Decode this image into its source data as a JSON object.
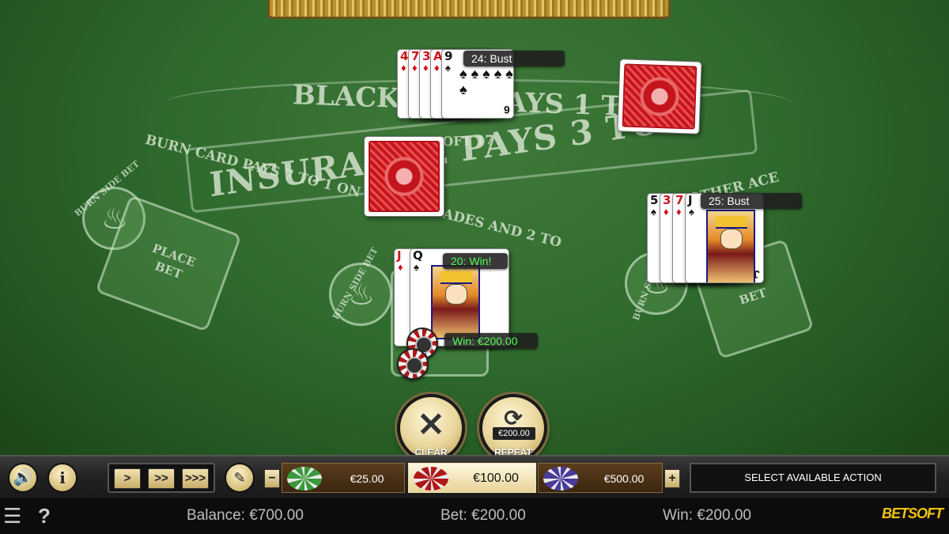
{
  "table": {
    "title_text": "BLACKJACK PAYS 1 TO",
    "rule_text": "HITS ON SOFT 17",
    "insurance_text": "INSURANCE PAYS 3 TO 2",
    "burn_rule_text": "BURN CARD PAYS 7 TO 1 ON ACE OF SPADES AND 2 TO",
    "burn_rule_text_2": "OTHER ACE",
    "burn_side_bet": "BURN SIDE BET",
    "place_bet": "PLACE\nBET",
    "bet_spot_right": "BET"
  },
  "hands": {
    "dealer": {
      "label": "24: Bust",
      "cards": [
        {
          "rank": "4",
          "suit": "♦",
          "color": "red"
        },
        {
          "rank": "7",
          "suit": "♦",
          "color": "red"
        },
        {
          "rank": "3",
          "suit": "♦",
          "color": "red"
        },
        {
          "rank": "A",
          "suit": "♦",
          "color": "red"
        },
        {
          "rank": "9",
          "suit": "♠",
          "color": "black"
        }
      ],
      "last_card_corner": "6"
    },
    "player_center": {
      "label": "20: Win!",
      "win_text": "Win: €200.00",
      "cards": [
        {
          "rank": "J",
          "suit": "♦",
          "color": "red"
        },
        {
          "rank": "Q",
          "suit": "♠",
          "color": "black"
        }
      ]
    },
    "player_right": {
      "label": "25: Bust",
      "cards": [
        {
          "rank": "5",
          "suit": "♠",
          "color": "black"
        },
        {
          "rank": "3",
          "suit": "♦",
          "color": "red"
        },
        {
          "rank": "7",
          "suit": "♦",
          "color": "red"
        },
        {
          "rank": "J",
          "suit": "♠",
          "color": "black"
        }
      ],
      "last_card_corner": "J"
    }
  },
  "actions": {
    "clear_label": "CLEAR",
    "repeat_label": "REPEAT",
    "repeat_amount": "€200.00"
  },
  "controls": {
    "sound_icon": "speaker-icon",
    "info_icon": "info-icon",
    "speed": [
      ">",
      ">>",
      ">>>"
    ],
    "chips": [
      {
        "label": "€25.00",
        "color": "#3a9a3a"
      },
      {
        "label": "€100.00",
        "color": "#b01818",
        "selected": true
      },
      {
        "label": "€500.00",
        "color": "#4a3a9a"
      }
    ],
    "minus": "−",
    "plus": "+",
    "status": "SELECT AVAILABLE ACTION"
  },
  "infobar": {
    "balance": "Balance: €700.00",
    "bet": "Bet: €200.00",
    "win": "Win: €200.00",
    "logo": "BETSOFT"
  }
}
